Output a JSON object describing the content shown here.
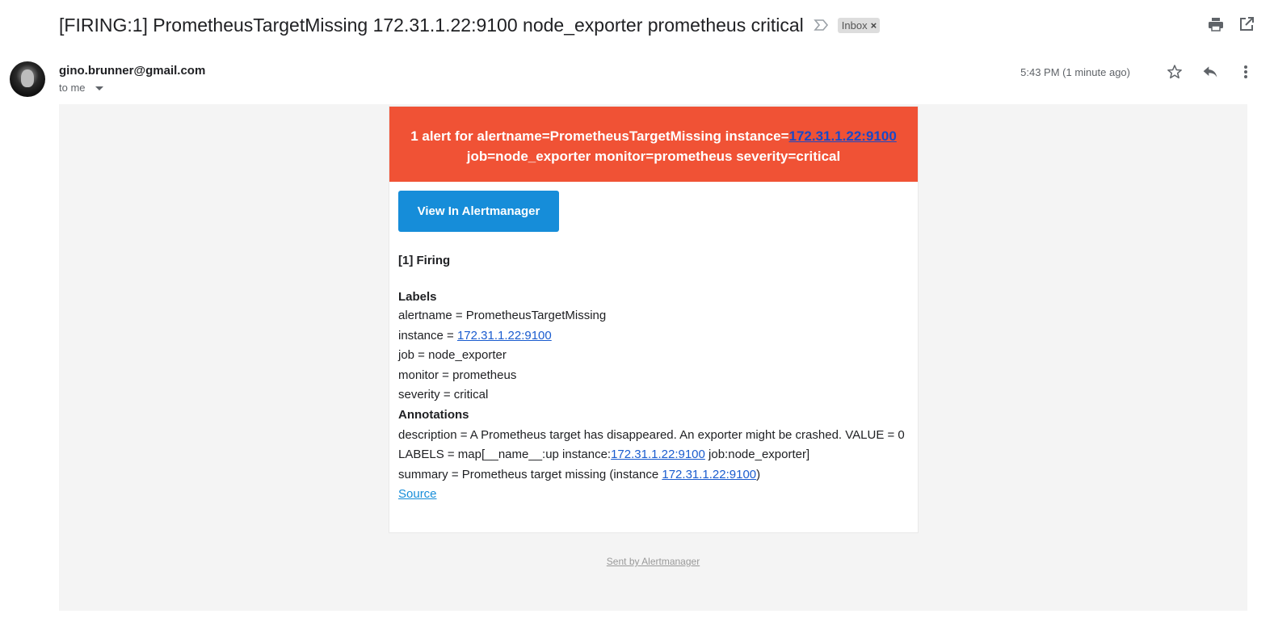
{
  "email": {
    "subject": "[FIRING:1] PrometheusTargetMissing 172.31.1.22:9100 node_exporter prometheus critical",
    "inbox_label": "Inbox",
    "sender": "gino.brunner@gmail.com",
    "recipient": "to me",
    "timestamp": "5:43 PM (1 minute ago)"
  },
  "alert": {
    "header_prefix": "1 alert for alertname=PrometheusTargetMissing instance=",
    "header_instance": "172.31.1.22:9100",
    "header_line2": "job=node_exporter monitor=prometheus severity=critical",
    "button_label": "View In Alertmanager",
    "firing_title": "[1] Firing",
    "labels_title": "Labels",
    "labels": {
      "alertname": "alertname = PrometheusTargetMissing",
      "instance_prefix": "instance = ",
      "instance_link": "172.31.1.22:9100",
      "job": "job = node_exporter",
      "monitor": "monitor = prometheus",
      "severity": "severity = critical"
    },
    "annotations_title": "Annotations",
    "annotations": {
      "description_part1": "description = A Prometheus target has disappeared. An exporter might be crashed. VALUE = 0 LABELS = map[__name__:up instance:",
      "description_link": "172.31.1.22:9100",
      "description_part2": " job:node_exporter]",
      "summary_prefix": "summary = Prometheus target missing (instance ",
      "summary_link": "172.31.1.22:9100",
      "summary_suffix": ")"
    },
    "source_link": "Source",
    "footer_link": "Sent by Alertmanager"
  },
  "colors": {
    "alert_header_bg": "#f05235",
    "button_bg": "#168dd9",
    "link": "#1a5ccf"
  },
  "icons": [
    "important-marker-icon",
    "close-icon",
    "print-icon",
    "open-in-new-window-icon",
    "star-icon",
    "reply-icon",
    "more-vert-icon",
    "dropdown-caret-icon"
  ]
}
